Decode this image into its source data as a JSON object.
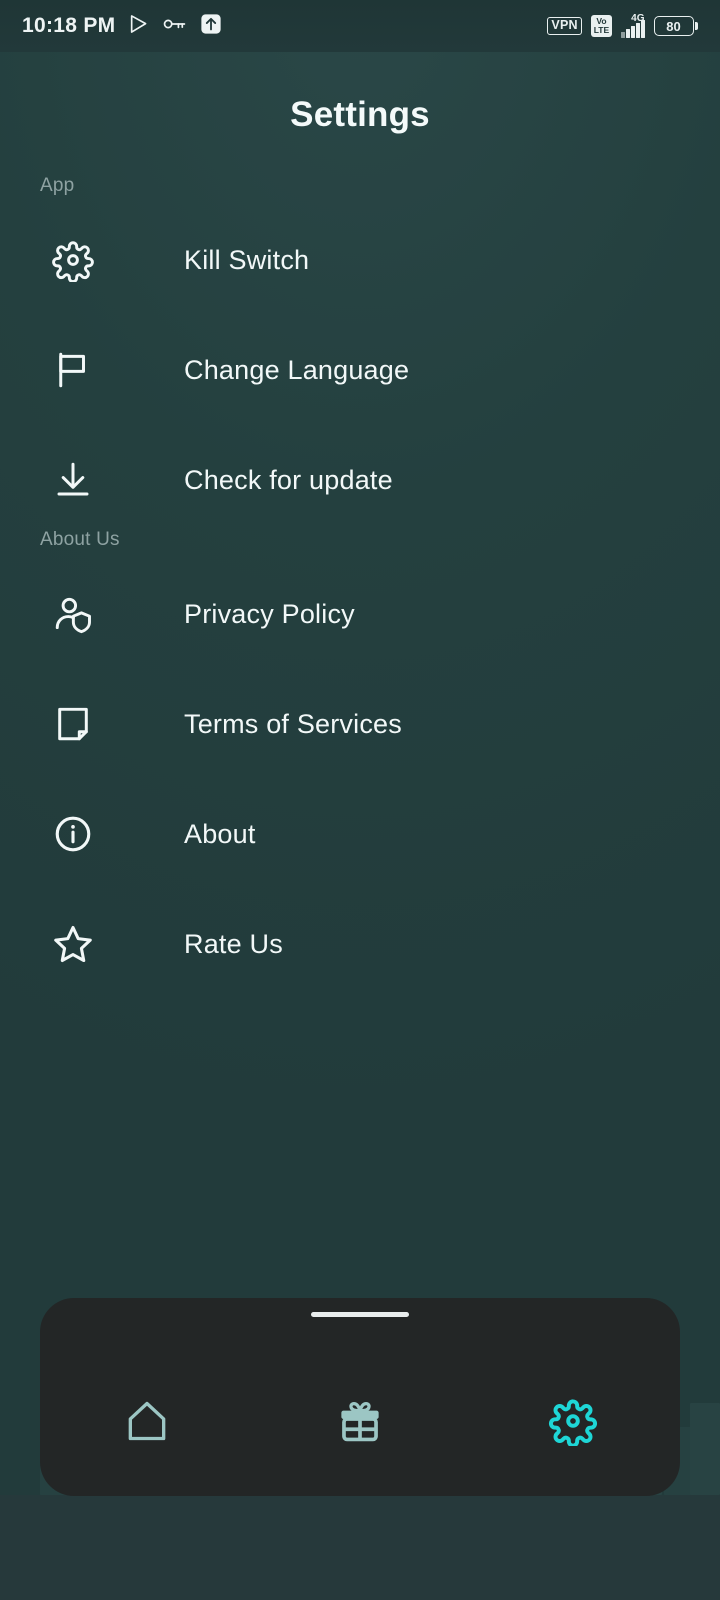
{
  "theme": {
    "background": "#24403f",
    "text_primary": "#f2f8f8",
    "text_muted": "#8ea2a2",
    "nav_card": "#232626",
    "accent_active": "#1ed6d6",
    "nav_icon_inactive": "#9cc6c4"
  },
  "status_bar": {
    "time": "10:18 PM",
    "left_icons": [
      {
        "name": "play-store-icon"
      },
      {
        "name": "key-icon"
      },
      {
        "name": "upload-arrow-icon"
      }
    ],
    "vpn_label": "VPN",
    "volte_top": "Vo",
    "volte_bottom": "LTE",
    "network_type": "4G",
    "signal_bars": 4,
    "battery_level": "80"
  },
  "header": {
    "title": "Settings"
  },
  "sections": [
    {
      "label": "App",
      "items": [
        {
          "icon": "gear-icon",
          "label": "Kill Switch"
        },
        {
          "icon": "flag-icon",
          "label": "Change Language"
        },
        {
          "icon": "download-icon",
          "label": "Check for update"
        }
      ]
    },
    {
      "label": "About Us",
      "items": [
        {
          "icon": "user-shield-icon",
          "label": "Privacy Policy"
        },
        {
          "icon": "document-icon",
          "label": "Terms of Services"
        },
        {
          "icon": "info-circle-icon",
          "label": "About"
        },
        {
          "icon": "star-icon",
          "label": "Rate Us"
        }
      ]
    }
  ],
  "bottom_nav": {
    "items": [
      {
        "icon": "home-icon",
        "label": "Home",
        "active": false
      },
      {
        "icon": "gift-icon",
        "label": "Rewards",
        "active": false
      },
      {
        "icon": "gear-icon",
        "label": "Settings",
        "active": true
      }
    ]
  }
}
